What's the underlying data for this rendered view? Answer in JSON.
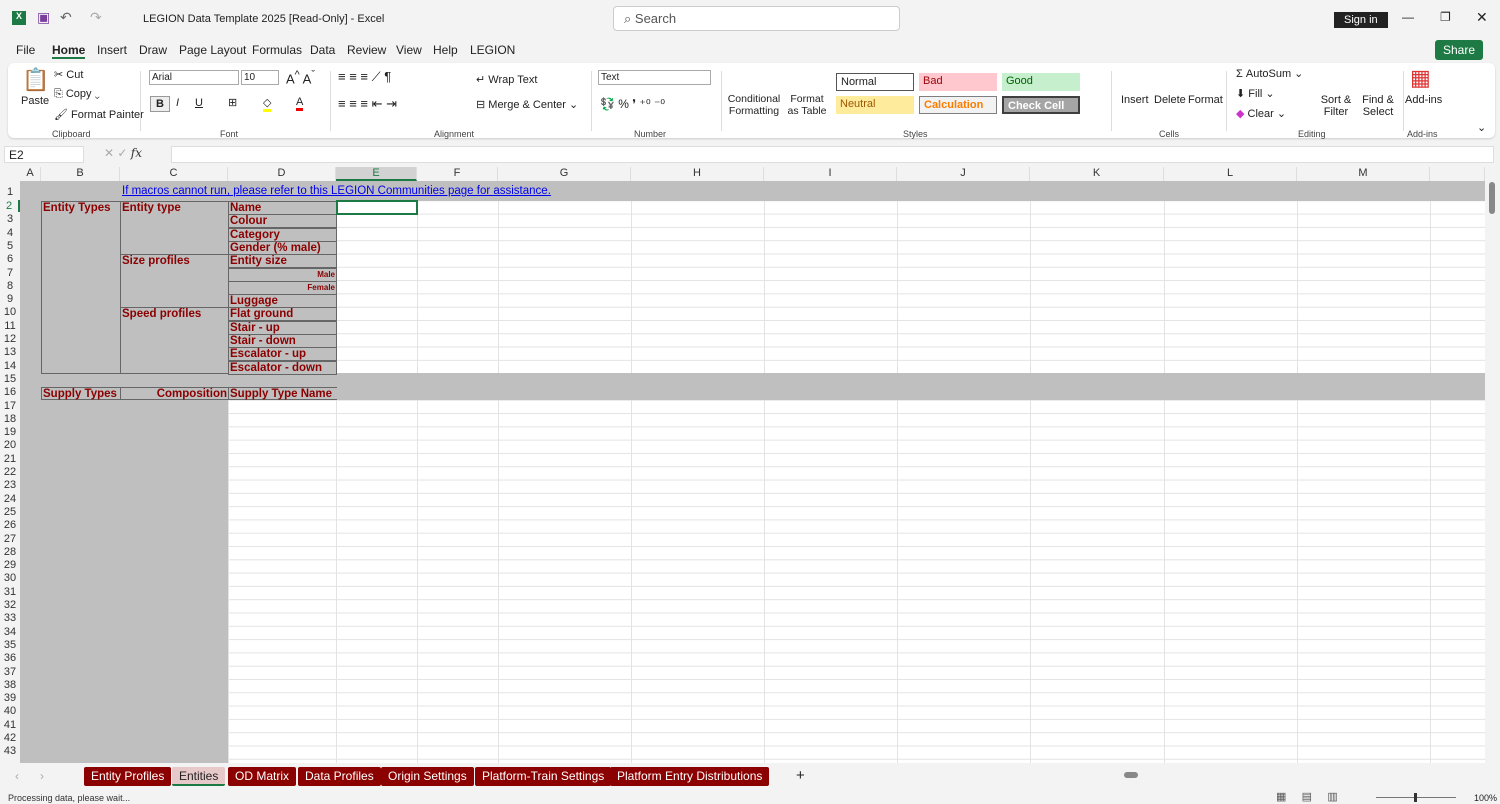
{
  "app": {
    "title": "LEGION Data Template 2025  [Read-Only]  -  Excel",
    "search_placeholder": "Search",
    "sign_in": "Sign in",
    "share": "Share"
  },
  "menu": [
    "File",
    "Home",
    "Insert",
    "Draw",
    "Page Layout",
    "Formulas",
    "Data",
    "Review",
    "View",
    "Help",
    "LEGION"
  ],
  "ribbon": {
    "clipboard": {
      "paste": "Paste",
      "cut": "Cut",
      "copy": "Copy",
      "format_painter": "Format Painter",
      "label": "Clipboard"
    },
    "font": {
      "name": "Arial",
      "size": "10",
      "label": "Font"
    },
    "alignment": {
      "wrap": "Wrap Text",
      "merge": "Merge & Center",
      "label": "Alignment"
    },
    "number": {
      "format": "Text",
      "label": "Number"
    },
    "styles": {
      "conditional": "Conditional Formatting",
      "format_table": "Format as Table",
      "normal": "Normal",
      "bad": "Bad",
      "good": "Good",
      "neutral": "Neutral",
      "calculation": "Calculation",
      "check": "Check Cell",
      "label": "Styles"
    },
    "cells": {
      "insert": "Insert",
      "delete": "Delete",
      "format": "Format",
      "label": "Cells"
    },
    "editing": {
      "autosum": "AutoSum",
      "fill": "Fill",
      "clear": "Clear",
      "sort": "Sort & Filter",
      "find": "Find & Select",
      "label": "Editing"
    },
    "addins": {
      "addins": "Add-ins",
      "label": "Add-ins"
    }
  },
  "formula": {
    "name_box": "E2",
    "fx": "fx",
    "value": ""
  },
  "columns": [
    "A",
    "B",
    "C",
    "D",
    "E",
    "F",
    "G",
    "H",
    "I",
    "J",
    "K",
    "L",
    "M"
  ],
  "sheet": {
    "link": "If macros cannot run, please refer to this LEGION Communities page for assistance.",
    "entity_types": "Entity Types",
    "entity_type": "Entity type",
    "size_profiles": "Size profiles",
    "speed_profiles": "Speed profiles",
    "d_labels": [
      "Name",
      "Colour",
      "Category",
      "Gender (% male)",
      "Entity size",
      "Male",
      "Female",
      "Luggage",
      "Flat ground",
      "Stair - up",
      "Stair - down",
      "Escalator - up",
      "Escalator - down"
    ],
    "supply_types": "Supply Types",
    "composition": "Composition",
    "supply_type_name": "Supply Type Name"
  },
  "tabs": [
    "Entity Profiles",
    "Entities",
    "OD Matrix",
    "Data Profiles",
    "Origin Settings",
    "Platform-Train Settings",
    "Platform Entry Distributions"
  ],
  "active_tab": "Entities",
  "status": {
    "text": "Processing data, please wait...",
    "zoom": "100%"
  }
}
